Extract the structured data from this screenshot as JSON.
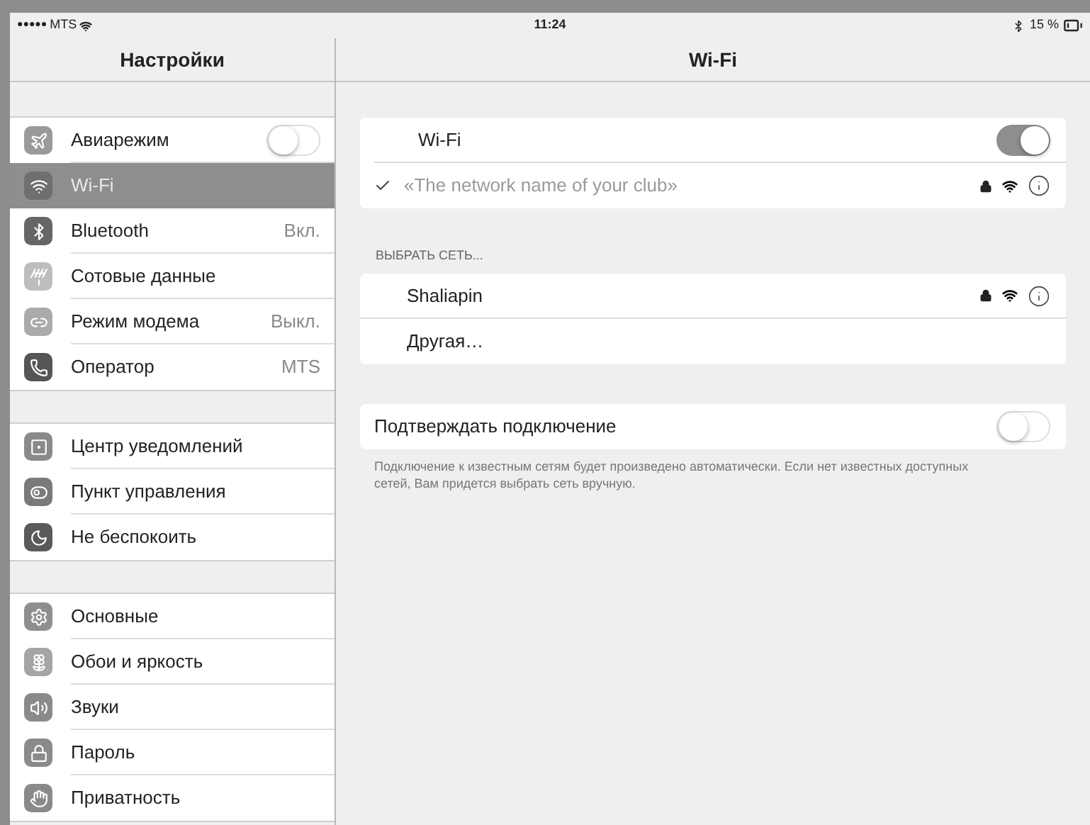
{
  "status_bar": {
    "signal": "●●●●●",
    "carrier": "MTS",
    "time": "11:24",
    "battery": "15 %"
  },
  "sidebar": {
    "title": "Настройки",
    "groups": [
      [
        {
          "label": "Авиарежим",
          "kind": "toggle",
          "on": false,
          "selected": false
        },
        {
          "label": "Wi-Fi",
          "kind": "link",
          "selected": true
        },
        {
          "label": "Bluetooth",
          "value": "Вкл.",
          "kind": "link",
          "selected": false
        },
        {
          "label": "Сотовые данные",
          "kind": "link",
          "selected": false
        },
        {
          "label": "Режим модема",
          "value": "Выкл.",
          "kind": "link",
          "selected": false
        },
        {
          "label": "Оператор",
          "value": "MTS",
          "kind": "link",
          "selected": false
        }
      ],
      [
        {
          "label": "Центр уведомлений",
          "kind": "link",
          "selected": false
        },
        {
          "label": "Пункт управления",
          "kind": "link",
          "selected": false
        },
        {
          "label": "Не беспокоить",
          "kind": "link",
          "selected": false
        }
      ],
      [
        {
          "label": "Основные",
          "kind": "link",
          "selected": false
        },
        {
          "label": "Обои и яркость",
          "kind": "link",
          "selected": false
        },
        {
          "label": "Звуки",
          "kind": "link",
          "selected": false
        },
        {
          "label": "Пароль",
          "kind": "link",
          "selected": false
        },
        {
          "label": "Приватность",
          "kind": "link",
          "selected": false
        }
      ]
    ]
  },
  "detail": {
    "title": "Wi-Fi",
    "wifi": {
      "label": "Wi-Fi",
      "on": true
    },
    "current_network": {
      "name": "«The network name of your club»",
      "checked": true
    },
    "section_header": "ВЫБРАТЬ СЕТЬ...",
    "networks": [
      {
        "name": "Shaliapin",
        "kind": "network"
      },
      {
        "name": "Другая…",
        "kind": "other"
      }
    ],
    "ask_to_join": {
      "label": "Подтверждать подключение",
      "on": false
    },
    "footnote": "Подключение к известным сетям будет произведено автоматически. Если нет известных доступных сетей, Вам придется выбрать сеть вручную."
  }
}
